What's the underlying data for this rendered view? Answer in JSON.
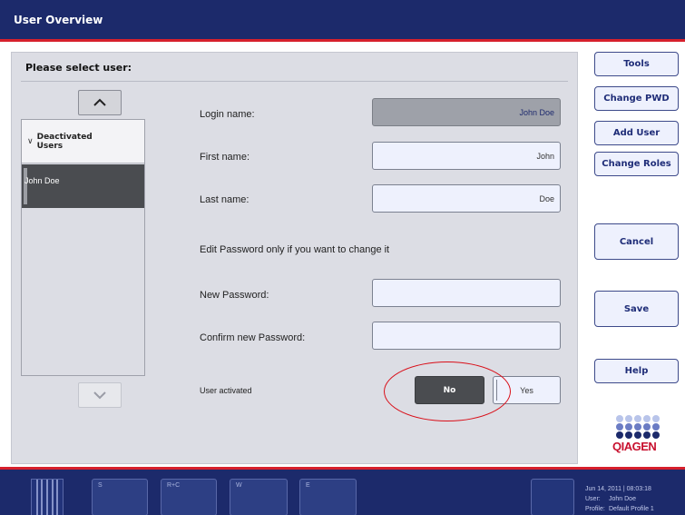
{
  "window": {
    "title": "User Overview"
  },
  "main": {
    "heading": "Please select user:"
  },
  "userlist": {
    "group": {
      "label": "Deactivated Users",
      "icon": "chevron-down-icon"
    },
    "items": [
      {
        "label": "John Doe",
        "selected": true
      }
    ]
  },
  "form": {
    "login_label": "Login name:",
    "login_value": "John Doe",
    "first_label": "First name:",
    "first_value": "John",
    "last_label": "Last name:",
    "last_value": "Doe",
    "password_note": "Edit Password only if you want to change it",
    "new_pw_label": "New Password:",
    "new_pw_value": "",
    "confirm_pw_label": "Confirm new Password:",
    "confirm_pw_value": "",
    "activated_label": "User activated",
    "toggle_no": "No",
    "toggle_yes": "Yes",
    "activated_selected": "No"
  },
  "sidebar": {
    "tools": "Tools",
    "change_pwd": "Change PWD",
    "add_user": "Add User",
    "change_roles": "Change Roles",
    "cancel": "Cancel",
    "save": "Save",
    "help": "Help"
  },
  "logo": {
    "text": "QIAGEN"
  },
  "statusbar": {
    "slots": [
      "S",
      "R+C",
      "W",
      "E"
    ],
    "datetime": "Jun 14, 2011 | 08:03:18",
    "user_label": "User:",
    "user_value": "John Doe",
    "profile_label": "Profile:",
    "profile_value": "Default Profile 1"
  },
  "colors": {
    "title_bar": "#1c2a6b",
    "accent_red": "#d6202c",
    "button_text": "#1f2d78",
    "selected_dark": "#4a4c50"
  }
}
